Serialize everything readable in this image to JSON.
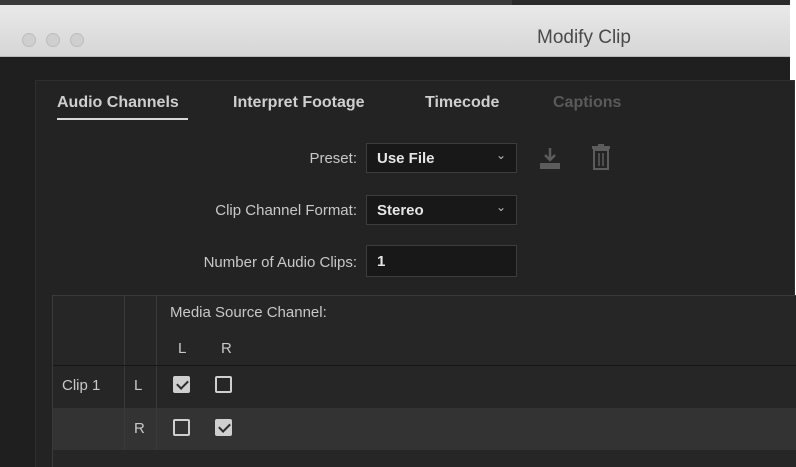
{
  "window": {
    "title": "Modify Clip"
  },
  "tabs": [
    {
      "label": "Audio Channels",
      "active": true
    },
    {
      "label": "Interpret Footage",
      "active": false
    },
    {
      "label": "Timecode",
      "active": false
    },
    {
      "label": "Captions",
      "active": false,
      "disabled": true
    }
  ],
  "form": {
    "preset_label": "Preset:",
    "preset_value": "Use File",
    "format_label": "Clip Channel Format:",
    "format_value": "Stereo",
    "num_clips_label": "Number of Audio Clips:",
    "num_clips_value": "1"
  },
  "icons": {
    "save": "save-preset-icon",
    "delete": "trash-icon"
  },
  "table": {
    "header": "Media Source Channel:",
    "columns": [
      "L",
      "R"
    ],
    "clip_label": "Clip 1",
    "rows": [
      {
        "channel": "L",
        "checks": [
          true,
          false
        ]
      },
      {
        "channel": "R",
        "checks": [
          false,
          true
        ]
      }
    ]
  },
  "colors": {
    "background": "#1f1f1f",
    "titlebar": "#dedede",
    "text": "#c8c8c8"
  }
}
